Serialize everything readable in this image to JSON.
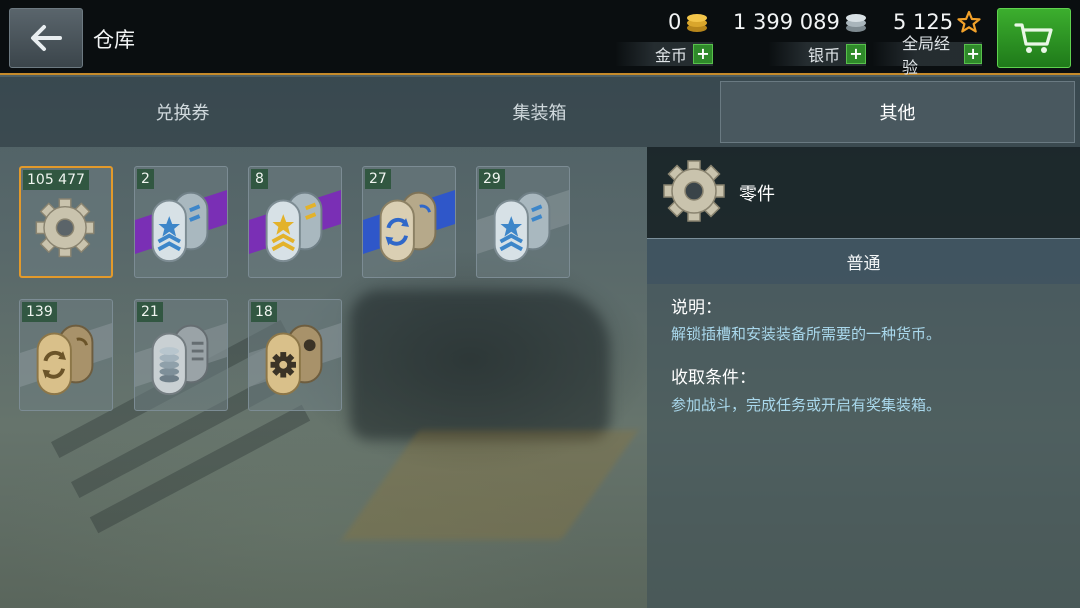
{
  "header": {
    "title": "仓库",
    "gold": {
      "value": "0",
      "label": "金币"
    },
    "silver": {
      "value": "1 399 089",
      "label": "银币"
    },
    "xp": {
      "value": "5 125",
      "label": "全局经验"
    },
    "plus": "+"
  },
  "tabs": [
    {
      "label": "兑换券",
      "active": false
    },
    {
      "label": "集装箱",
      "active": false
    },
    {
      "label": "其他",
      "active": true
    }
  ],
  "items": [
    {
      "count": "105 477",
      "icon": "gear-icon",
      "selected": true
    },
    {
      "count": "2",
      "icon": "star-chevron-dogtag-icon",
      "band": "#7a2fb5"
    },
    {
      "count": "8",
      "icon": "gold-star-dogtag-icon",
      "band": "#7a2fb5"
    },
    {
      "count": "27",
      "icon": "refresh-dogtag-icon",
      "band": "#2f57c9"
    },
    {
      "count": "29",
      "icon": "star-chevron-dogtag-icon",
      "band": ""
    },
    {
      "count": "139",
      "icon": "refresh-dogtag-icon",
      "band": ""
    },
    {
      "count": "21",
      "icon": "coins-dogtag-icon",
      "band": ""
    },
    {
      "count": "18",
      "icon": "gear-dogtag-icon",
      "band": ""
    }
  ],
  "detail": {
    "name": "零件",
    "rarity": "普通",
    "description_title": "说明：",
    "description": "解锁插槽和安装装备所需要的一种货币。",
    "acquire_title": "收取条件：",
    "acquire": "参加战斗，完成任务或开启有奖集装箱。"
  },
  "colors": {
    "accent": "#e39a2b",
    "buy": "#2f8a2a",
    "info_text": "#a9d8ec"
  }
}
